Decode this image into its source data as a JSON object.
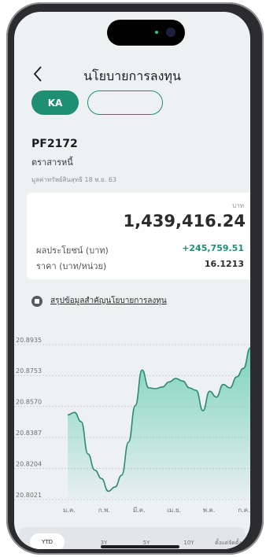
{
  "header": {
    "title": "นโยบายการลงทุน"
  },
  "segments": [
    {
      "label": "KA"
    },
    {
      "label": ""
    }
  ],
  "fund": {
    "code": "PF2172",
    "type": "ตราสารหนี้",
    "nav_date": "มูลค่าทรัพย์สินสุทธิ 18 พ.ย. 63"
  },
  "card": {
    "unit": "บาท",
    "total": "1,439,416.24",
    "gain_label": "ผลประโยชน์ (บาท)",
    "gain_value": "+245,759.51",
    "price_label": "ราคา (บาท/หน่วย)",
    "price_value": "16.1213"
  },
  "summary_link": "สรุปข้อมูลสำคัญนโยบายการลงทุน",
  "colors": {
    "accent": "#1f8f74",
    "line": "#2e8b6e",
    "fill_top": "#78d3b6"
  },
  "chart_data": {
    "type": "area",
    "title": "",
    "xlabel": "",
    "ylabel": "",
    "y_ticks": [
      "20.8935",
      "20.8753",
      "20.8570",
      "20.8387",
      "20.8204",
      "20.8021"
    ],
    "ylim": [
      20.8021,
      20.8935
    ],
    "x_tick_labels": [
      "ม.ค.",
      "ก.พ.",
      "มี.ค.",
      "เม.ย.",
      "พ.ค.",
      "ก.ค."
    ],
    "grid": true,
    "values": [
      20.852,
      20.8535,
      20.848,
      20.829,
      20.8195,
      20.8145,
      20.807,
      20.8095,
      20.8165,
      20.836,
      20.8575,
      20.8785,
      20.868,
      20.8675,
      20.8685,
      20.8715,
      20.8735,
      20.872,
      20.868,
      20.8665,
      20.8545,
      20.866,
      20.8625,
      20.87,
      20.868,
      20.8745,
      20.8795,
      20.8915
    ]
  },
  "tabs": [
    {
      "label": "YTD",
      "active": true
    },
    {
      "label": "3Y"
    },
    {
      "label": "5Y"
    },
    {
      "label": "10Y"
    },
    {
      "label": "ตั้งแต่จัดตั้ง"
    }
  ]
}
